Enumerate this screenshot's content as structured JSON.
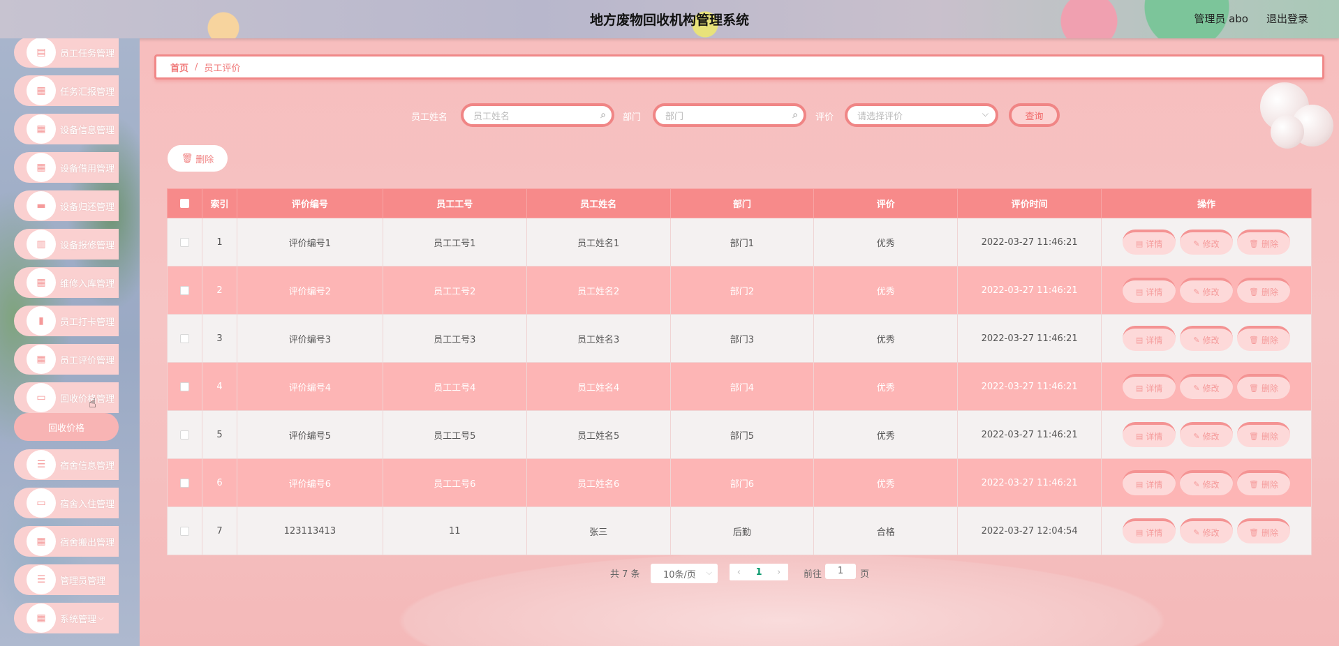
{
  "header": {
    "title": "地方废物回收机构管理系统",
    "user": "管理员 abo",
    "logout": "退出登录"
  },
  "sidebar": {
    "items": [
      {
        "label": "员工任务管理",
        "icon": "clipboard-icon"
      },
      {
        "label": "任务汇报管理",
        "icon": "grid-icon"
      },
      {
        "label": "设备信息管理",
        "icon": "grid-icon"
      },
      {
        "label": "设备借用管理",
        "icon": "grid-icon"
      },
      {
        "label": "设备归还管理",
        "icon": "chat-icon"
      },
      {
        "label": "设备报修管理",
        "icon": "chart-icon"
      },
      {
        "label": "维修入库管理",
        "icon": "grid-icon"
      },
      {
        "label": "员工打卡管理",
        "icon": "bar-chart-icon"
      },
      {
        "label": "员工评价管理",
        "icon": "table-icon"
      },
      {
        "label": "回收价格管理",
        "icon": "monitor-icon"
      }
    ],
    "submenu": "回收价格",
    "items_after": [
      {
        "label": "宿舍信息管理",
        "icon": "list-icon"
      },
      {
        "label": "宿舍入住管理",
        "icon": "monitor-icon"
      },
      {
        "label": "宿舍搬出管理",
        "icon": "grid-icon"
      },
      {
        "label": "管理员管理",
        "icon": "list-icon"
      },
      {
        "label": "系统管理",
        "icon": "grid-icon"
      }
    ]
  },
  "breadcrumb": {
    "home": "首页",
    "separator": "/",
    "current": "员工评价"
  },
  "search": {
    "name_label": "员工姓名",
    "name_placeholder": "员工姓名",
    "dept_label": "部门",
    "dept_placeholder": "部门",
    "rating_label": "评价",
    "rating_placeholder": "请选择评价",
    "query_button": "查询"
  },
  "toolbar": {
    "delete_label": "删除"
  },
  "table": {
    "headers": [
      "索引",
      "评价编号",
      "员工工号",
      "员工姓名",
      "部门",
      "评价",
      "评价时间",
      "操作"
    ],
    "rows": [
      [
        "1",
        "评价编号1",
        "员工工号1",
        "员工姓名1",
        "部门1",
        "优秀",
        "2022-03-27 11:46:21"
      ],
      [
        "2",
        "评价编号2",
        "员工工号2",
        "员工姓名2",
        "部门2",
        "优秀",
        "2022-03-27 11:46:21"
      ],
      [
        "3",
        "评价编号3",
        "员工工号3",
        "员工姓名3",
        "部门3",
        "优秀",
        "2022-03-27 11:46:21"
      ],
      [
        "4",
        "评价编号4",
        "员工工号4",
        "员工姓名4",
        "部门4",
        "优秀",
        "2022-03-27 11:46:21"
      ],
      [
        "5",
        "评价编号5",
        "员工工号5",
        "员工姓名5",
        "部门5",
        "优秀",
        "2022-03-27 11:46:21"
      ],
      [
        "6",
        "评价编号6",
        "员工工号6",
        "员工姓名6",
        "部门6",
        "优秀",
        "2022-03-27 11:46:21"
      ],
      [
        "7",
        "123113413",
        "11",
        "张三",
        "后勤",
        "合格",
        "2022-03-27 12:04:54"
      ]
    ],
    "actions": {
      "detail": "详情",
      "edit": "修改",
      "delete": "删除"
    }
  },
  "pagination": {
    "total": "共 7 条",
    "page_size": "10条/页",
    "current_page": "1",
    "goto_label": "前往",
    "goto_value": "1",
    "page_suffix": "页"
  },
  "colors": {
    "accent": "#f08585",
    "header_row": "#f78a8a",
    "even_row": "#fdb5b5",
    "odd_row": "#f4f1f1"
  }
}
